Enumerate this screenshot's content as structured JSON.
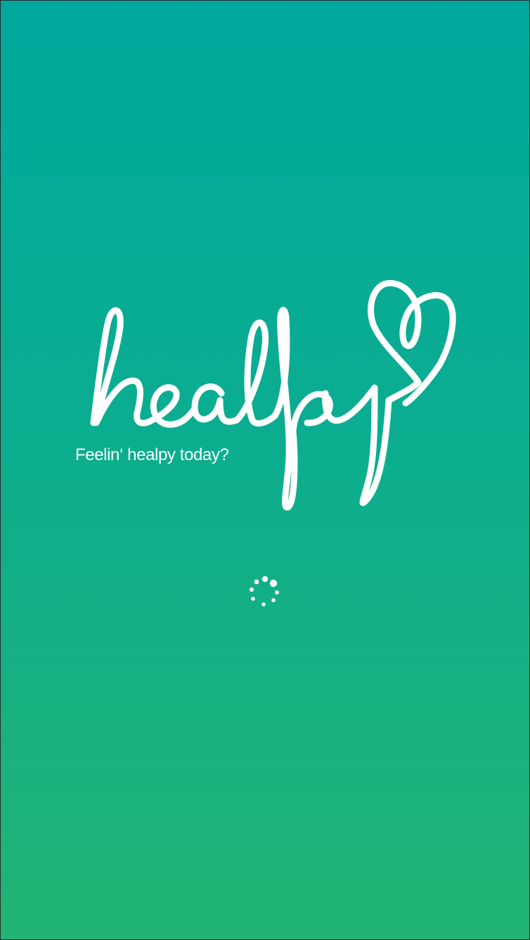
{
  "app": {
    "logo_text": "healpy",
    "tagline": "Feelin‘ healpy today?"
  },
  "loading": {
    "icon": "loading-spinner-icon"
  },
  "colors": {
    "gradient_top": "#00a99d",
    "gradient_bottom": "#21b473",
    "foreground": "#ffffff"
  }
}
